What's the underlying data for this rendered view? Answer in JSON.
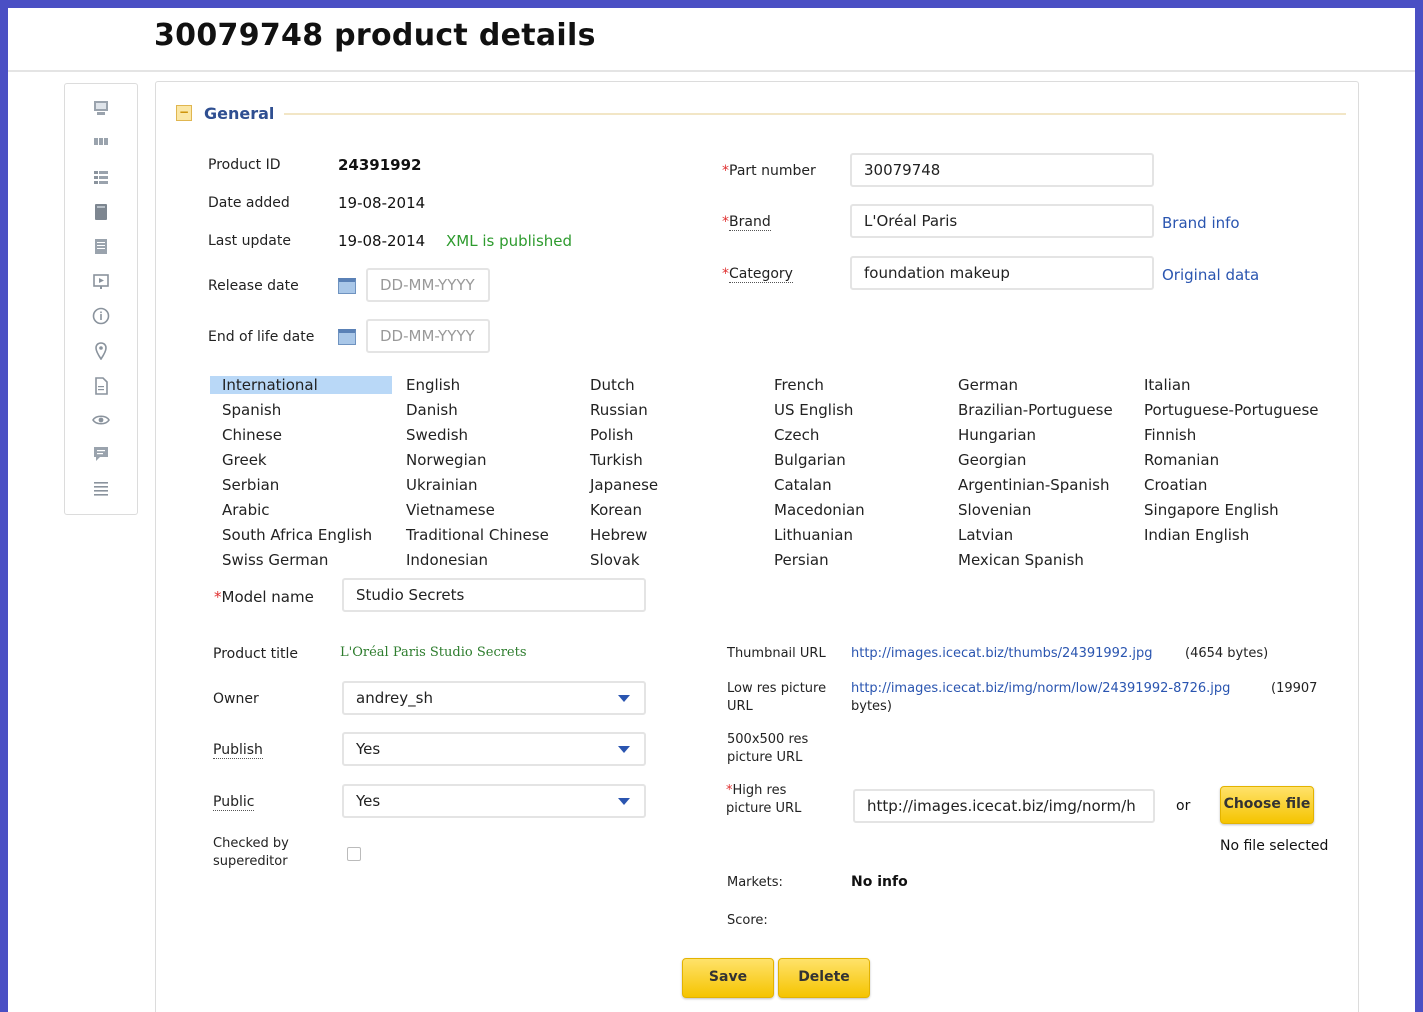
{
  "header": {
    "title": "30079748 product details"
  },
  "sidebar": {
    "icons": [
      "monitor-icon",
      "columns-icon",
      "list-icon",
      "book-icon",
      "notepad-icon",
      "slideshow-icon",
      "info-icon",
      "location-pin-icon",
      "document-icon",
      "eye-icon",
      "comment-icon",
      "menu-lines-icon"
    ]
  },
  "section": {
    "title": "General",
    "collapse_symbol": "−"
  },
  "left_fields": {
    "product_id_label": "Product ID",
    "product_id_value": "24391992",
    "date_added_label": "Date added",
    "date_added_value": "19-08-2014",
    "last_update_label": "Last update",
    "last_update_value": "19-08-2014",
    "xml_status": "XML is published",
    "release_date_label": "Release date",
    "release_date_placeholder": "DD-MM-YYYY",
    "eol_date_label": "End of life date",
    "eol_date_placeholder": "DD-MM-YYYY"
  },
  "right_fields": {
    "required_mark": "*",
    "part_number_label": "Part number",
    "part_number_value": "30079748",
    "brand_label": "Brand",
    "brand_value": "L'Oréal Paris",
    "brand_link": "Brand info",
    "category_label": "Category",
    "category_value": "foundation makeup",
    "category_link": "Original data"
  },
  "languages": {
    "col1": [
      "International",
      "Spanish",
      "Chinese",
      "Greek",
      "Serbian",
      "Arabic",
      "South Africa English",
      "Swiss German"
    ],
    "col2": [
      "English",
      "Danish",
      "Swedish",
      "Norwegian",
      "Ukrainian",
      "Vietnamese",
      "Traditional Chinese",
      "Indonesian"
    ],
    "col3": [
      "Dutch",
      "Russian",
      "Polish",
      "Turkish",
      "Japanese",
      "Korean",
      "Hebrew",
      "Slovak"
    ],
    "col4": [
      "French",
      "US English",
      "Czech",
      "Bulgarian",
      "Catalan",
      "Macedonian",
      "Lithuanian",
      "Persian"
    ],
    "col5": [
      "German",
      "Brazilian-Portuguese",
      "Hungarian",
      "Georgian",
      "Argentinian-Spanish",
      "Slovenian",
      "Latvian",
      "Mexican Spanish"
    ],
    "col6": [
      "Italian",
      "Portuguese-Portuguese",
      "Finnish",
      "Romanian",
      "Croatian",
      "Singapore English",
      "Indian English"
    ],
    "selected": "International"
  },
  "model": {
    "label": "Model name",
    "value": "Studio Secrets"
  },
  "product": {
    "title_label": "Product title",
    "title_value": "L'Oréal Paris Studio Secrets",
    "owner_label": "Owner",
    "owner_value": "andrey_sh",
    "publish_label": "Publish",
    "publish_value": "Yes",
    "public_label": "Public",
    "public_value": "Yes",
    "checked_label_1": "Checked by",
    "checked_label_2": "supereditor",
    "checked": false
  },
  "images": {
    "thumb_label": "Thumbnail URL",
    "thumb_url": "http://images.icecat.biz/thumbs/24391992.jpg",
    "thumb_size": "(4654 bytes)",
    "lowres_label_1": "Low res picture",
    "lowres_label_2": "URL",
    "lowres_url": "http://images.icecat.biz/img/norm/low/24391992-8726.jpg",
    "lowres_size_1": "(19907",
    "lowres_size_2": "bytes)",
    "res500_label_1": "500x500 res",
    "res500_label_2": "picture URL",
    "highres_label_1": "High res",
    "highres_label_2": "picture URL",
    "highres_value": "http://images.icecat.biz/img/norm/h",
    "or_text": "or",
    "choose_file": "Choose file",
    "no_file": "No file selected"
  },
  "meta": {
    "markets_label": "Markets:",
    "markets_value": "No info",
    "score_label": "Score:"
  },
  "actions": {
    "save": "Save",
    "delete": "Delete"
  },
  "colors": {
    "accent": "#2a55b0",
    "button": "#f5c400",
    "green": "#2e9b2e",
    "required": "#e03030",
    "frame": "#4a4fc4"
  }
}
